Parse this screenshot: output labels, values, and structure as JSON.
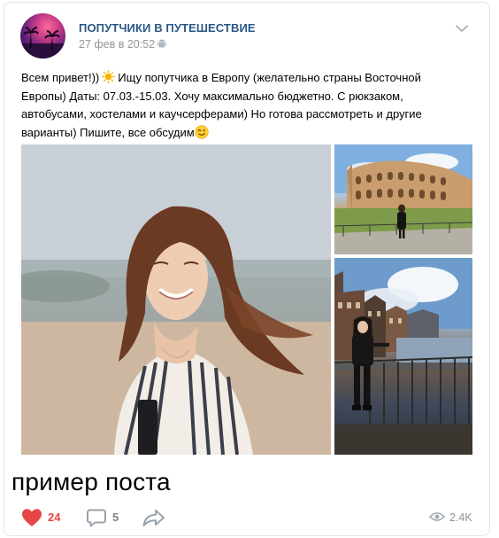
{
  "post": {
    "group_name": "ПОПУТЧИКИ В ПУТЕШЕСТВИЕ",
    "date": "27 фев в 20:52",
    "text_lines": [
      "Всем привет!))",
      "Ищу попутчика в Европу (желательно страны Восточной",
      "Европы) Даты: 07.03.-15.03. Хочу максимально бюджетно. С рюкзаком,",
      "автобусами, хостелами и каучсерферами) Но готова рассмотреть и другие",
      "варианты) Пишите, все обсудим"
    ],
    "photos": [
      {
        "name": "photo-portrait-girl"
      },
      {
        "name": "photo-colosseum"
      },
      {
        "name": "photo-amsterdam-canal"
      }
    ]
  },
  "caption": "пример поста",
  "footer": {
    "likes": "24",
    "comments": "5",
    "views": "2.4K"
  },
  "colors": {
    "link": "#2a5885",
    "like": "#e64646",
    "muted": "#939393"
  },
  "icons": [
    "android-icon",
    "chevron-down-icon",
    "sun-emoji-icon",
    "wink-emoji-icon",
    "heart-icon",
    "comment-icon",
    "share-icon",
    "eye-icon"
  ]
}
